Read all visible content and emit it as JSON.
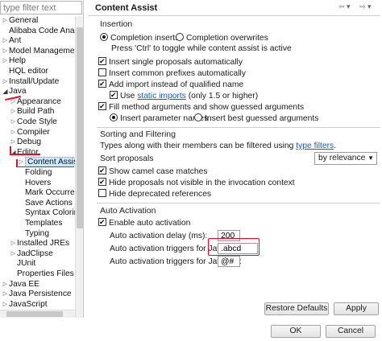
{
  "tree": {
    "filter_placeholder": "type filter text",
    "items": [
      {
        "label": "General",
        "level": 0,
        "twisty": "closed"
      },
      {
        "label": "Alibaba Code Analysis",
        "level": 0,
        "twisty": "none"
      },
      {
        "label": "Ant",
        "level": 0,
        "twisty": "closed"
      },
      {
        "label": "Model Management",
        "level": 0,
        "twisty": "closed"
      },
      {
        "label": "Help",
        "level": 0,
        "twisty": "closed"
      },
      {
        "label": "HQL editor",
        "level": 0,
        "twisty": "none"
      },
      {
        "label": "Install/Update",
        "level": 0,
        "twisty": "closed"
      },
      {
        "label": "Java",
        "level": 0,
        "twisty": "open"
      },
      {
        "label": "Appearance",
        "level": 1,
        "twisty": "closed"
      },
      {
        "label": "Build Path",
        "level": 1,
        "twisty": "closed"
      },
      {
        "label": "Code Style",
        "level": 1,
        "twisty": "closed"
      },
      {
        "label": "Compiler",
        "level": 1,
        "twisty": "closed"
      },
      {
        "label": "Debug",
        "level": 1,
        "twisty": "closed"
      },
      {
        "label": "Editor",
        "level": 1,
        "twisty": "open"
      },
      {
        "label": "Content Assist",
        "level": 2,
        "twisty": "closed",
        "selected": true
      },
      {
        "label": "Folding",
        "level": 2,
        "twisty": "none"
      },
      {
        "label": "Hovers",
        "level": 2,
        "twisty": "none"
      },
      {
        "label": "Mark Occurren",
        "level": 2,
        "twisty": "none"
      },
      {
        "label": "Save Actions",
        "level": 2,
        "twisty": "none"
      },
      {
        "label": "Syntax Coloring",
        "level": 2,
        "twisty": "none"
      },
      {
        "label": "Templates",
        "level": 2,
        "twisty": "none"
      },
      {
        "label": "Typing",
        "level": 2,
        "twisty": "none"
      },
      {
        "label": "Installed JREs",
        "level": 1,
        "twisty": "closed"
      },
      {
        "label": "JadClipse",
        "level": 1,
        "twisty": "closed"
      },
      {
        "label": "JUnit",
        "level": 1,
        "twisty": "none"
      },
      {
        "label": "Properties Files Ed",
        "level": 1,
        "twisty": "none"
      },
      {
        "label": "Java EE",
        "level": 0,
        "twisty": "closed"
      },
      {
        "label": "Java Persistence",
        "level": 0,
        "twisty": "closed"
      },
      {
        "label": "JavaScript",
        "level": 0,
        "twisty": "closed"
      }
    ]
  },
  "page": {
    "title": "Content Assist",
    "insertion": {
      "heading": "Insertion",
      "radio_completion_inserts": "Completion inserts",
      "radio_completion_overwrites": "Completion overwrites",
      "hint": "Press 'Ctrl' to toggle while content assist is active",
      "insert_single": "Insert single proposals automatically",
      "insert_common": "Insert common prefixes automatically",
      "add_import": "Add import instead of qualified name",
      "use_prefix": "Use ",
      "static_imports_link": "static imports",
      "use_suffix": " (only 1.5 or higher)",
      "fill_method": "Fill method arguments and show guessed arguments",
      "radio_param_names": "Insert parameter names",
      "radio_best_guessed": "Insert best guessed arguments"
    },
    "sorting": {
      "heading": "Sorting and Filtering",
      "types_text": "Types along with their members can be filtered using ",
      "type_filters_link": "type filters",
      "types_suffix": ".",
      "sort_label": "Sort proposals",
      "sort_value": "by relevance",
      "show_camel": "Show camel case matches",
      "hide_not_visible": "Hide proposals not visible in the invocation context",
      "hide_deprecated": "Hide deprecated references"
    },
    "auto": {
      "heading": "Auto Activation",
      "enable": "Enable auto activation",
      "delay_label": "Auto activation delay (ms):",
      "delay_value": "200",
      "java_triggers_label": "Auto activation triggers for Java:",
      "java_triggers_value": ".abcd",
      "javadoc_triggers_label": "Auto activation triggers for Javadoc:",
      "javadoc_triggers_value": "@#"
    },
    "buttons": {
      "restore_defaults": "Restore Defaults",
      "apply": "Apply"
    }
  },
  "dialog": {
    "ok": "OK",
    "cancel": "Cancel"
  },
  "colors": {
    "annotation_red": "#e0102b",
    "link_blue": "#1a5bbf",
    "selection": "#cde8ff"
  }
}
